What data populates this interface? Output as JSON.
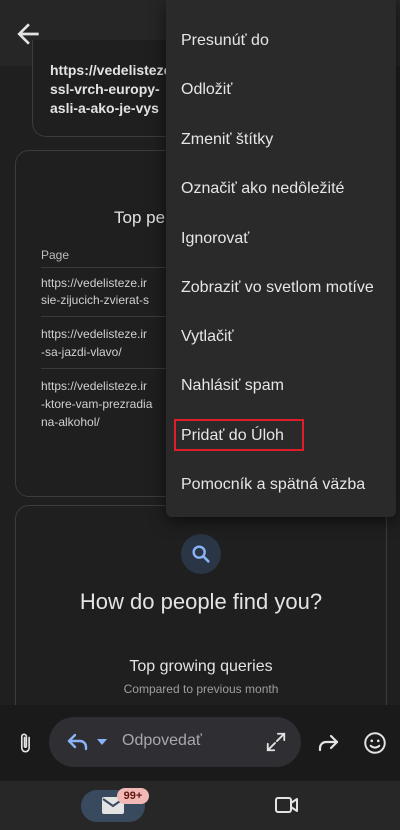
{
  "email": {
    "link_lines": [
      "https://vedelisteze",
      "ssl-vrch-europy-",
      "asli-a-ako-je-vys"
    ],
    "top_pages_title": "Top pe",
    "column_header": "Page",
    "urls": [
      [
        "https://vedelisteze.ir",
        "sie-zijucich-zvierat-s"
      ],
      [
        "https://vedelisteze.ir",
        "-sa-jazdi-vlavo/"
      ],
      [
        "https://vedelisteze.ir",
        "-ktore-vam-prezradia",
        "na-alkohol/"
      ]
    ],
    "find_title": "How do people find you?",
    "top_growing_queries": "Top growing queries",
    "compared_to": "Compared to previous month"
  },
  "reply": {
    "placeholder": "Odpovedať"
  },
  "bottom_nav": {
    "mail_badge": "99+"
  },
  "menu": {
    "items": [
      "Presunúť do",
      "Odložiť",
      "Zmeniť štítky",
      "Označiť ako nedôležité",
      "Ignorovať",
      "Zobraziť vo svetlom motíve",
      "Vytlačiť",
      "Nahlásiť spam",
      "Pridať do Úloh",
      "Pomocník a spätná väzba"
    ]
  },
  "colors": {
    "accent_blue": "#8ab4f8",
    "highlight_red": "#e01e2b",
    "badge_bg": "#f2b8b5"
  }
}
